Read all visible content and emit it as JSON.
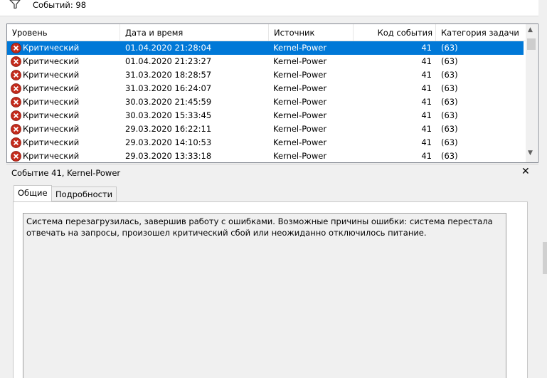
{
  "toolbar": {
    "events_count": "Событий: 98"
  },
  "grid": {
    "columns": [
      "Уровень",
      "Дата и время",
      "Источник",
      "Код события",
      "Категория задачи"
    ],
    "rows": [
      {
        "level": "Критический",
        "datetime": "01.04.2020 21:28:04",
        "source": "Kernel-Power",
        "code": "41",
        "category": "(63)"
      },
      {
        "level": "Критический",
        "datetime": "01.04.2020 21:23:27",
        "source": "Kernel-Power",
        "code": "41",
        "category": "(63)"
      },
      {
        "level": "Критический",
        "datetime": "31.03.2020 18:28:57",
        "source": "Kernel-Power",
        "code": "41",
        "category": "(63)"
      },
      {
        "level": "Критический",
        "datetime": "31.03.2020 16:24:07",
        "source": "Kernel-Power",
        "code": "41",
        "category": "(63)"
      },
      {
        "level": "Критический",
        "datetime": "30.03.2020 21:45:59",
        "source": "Kernel-Power",
        "code": "41",
        "category": "(63)"
      },
      {
        "level": "Критический",
        "datetime": "30.03.2020 15:33:45",
        "source": "Kernel-Power",
        "code": "41",
        "category": "(63)"
      },
      {
        "level": "Критический",
        "datetime": "29.03.2020 16:22:11",
        "source": "Kernel-Power",
        "code": "41",
        "category": "(63)"
      },
      {
        "level": "Критический",
        "datetime": "29.03.2020 14:10:53",
        "source": "Kernel-Power",
        "code": "41",
        "category": "(63)"
      },
      {
        "level": "Критический",
        "datetime": "29.03.2020 13:33:18",
        "source": "Kernel-Power",
        "code": "41",
        "category": "(63)"
      }
    ]
  },
  "detail": {
    "title": "Событие 41, Kernel-Power",
    "close": "✕",
    "tabs": [
      "Общие",
      "Подробности"
    ],
    "description": "Система перезагрузилась, завершив работу с ошибками. Возможные причины ошибки: система перестала отвечать на запросы, произошел критический сбой или неожиданно отключилось питание."
  },
  "colors": {
    "selection": "#0078d7",
    "error": "#c42b1c"
  }
}
